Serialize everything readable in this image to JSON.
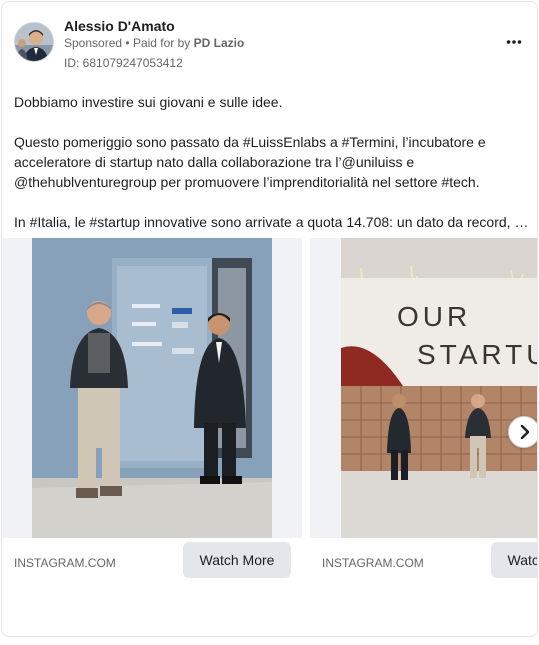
{
  "post": {
    "author": "Alessio D'Amato",
    "sponsored": "Sponsored",
    "separator": "•",
    "paid_for_prefix": "Paid for by",
    "paid_for_by": "PD Lazio",
    "ad_id": "ID: 681079247053412",
    "more_icon": "more-horizontal-icon"
  },
  "body": {
    "line1": "Dobbiamo investire sui giovani e sulle idee.",
    "line2": "Questo pomeriggio sono passato da #LuissEnlabs a #Termini, l’incubatore e",
    "line3": "acceleratore di startup nato dalla collaborazione tra l’@uniluiss e",
    "line4": "@thehublventuregroup per promuovere l’imprenditorialità nel settore #tech.",
    "line5": "In #Italia, le #startup innovative sono arrivate a quota 14.708: un dato da record, …"
  },
  "carousel": {
    "cards": [
      {
        "domain": "INSTAGRAM.COM",
        "cta": "Watch More"
      },
      {
        "domain": "INSTAGRAM.COM",
        "cta": "Watch More",
        "wall_text_1": "OUR",
        "wall_text_2": "STARTUP"
      }
    ],
    "next_icon": "chevron-right-icon"
  }
}
